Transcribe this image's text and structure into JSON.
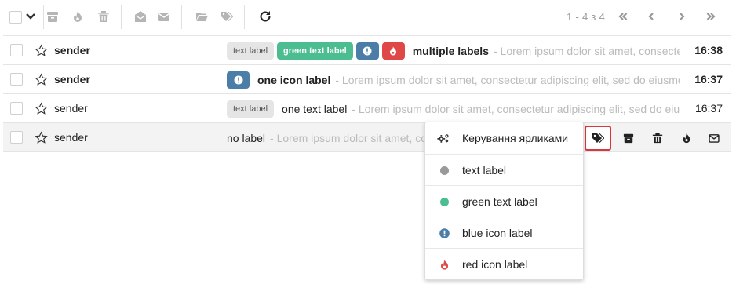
{
  "toolbar": {
    "pagination": "1 - 4 з 4",
    "icons": [
      "select-all-checkbox",
      "chevron-down-icon",
      "archive-icon",
      "spam-flame-icon",
      "trash-icon",
      "mark-read-icon",
      "mark-unread-icon",
      "move-folder-icon",
      "labels-icon",
      "refresh-icon"
    ]
  },
  "messages": [
    {
      "sender": "sender",
      "unread": true,
      "labels": [
        "text label",
        "green text label",
        "blue icon label",
        "red icon label"
      ],
      "subject": "multiple labels",
      "preview": "- Lorem ipsum dolor sit amet, consectetur adipiscing elit, sed do eiusmod tempor",
      "time": "16:38"
    },
    {
      "sender": "sender",
      "unread": true,
      "labels": [
        "blue icon label"
      ],
      "subject": "one icon label",
      "preview": "- Lorem ipsum dolor sit amet, consectetur adipiscing elit, sed do eiusmod tempor",
      "time": "16:37"
    },
    {
      "sender": "sender",
      "unread": false,
      "labels": [
        "text label"
      ],
      "subject": "one text label",
      "preview": "- Lorem ipsum dolor sit amet, consectetur adipiscing elit, sed do eiusmod tempor",
      "time": "16:37"
    },
    {
      "sender": "sender",
      "unread": false,
      "labels": [],
      "subject": "no label",
      "preview": "- Lorem ipsum dolor sit amet, consectetur adipiscing elit, sed do eiusmod tempor",
      "time": ""
    }
  ],
  "label_badges": {
    "text_label": "text label",
    "green_text_label": "green text label"
  },
  "dropdown": {
    "manage": "Керування ярликами",
    "items": [
      {
        "label": "text label",
        "color": "#999999",
        "icon": "gray-dot"
      },
      {
        "label": "green text label",
        "color": "#4bbd91",
        "icon": "green-dot"
      },
      {
        "label": "blue icon label",
        "color": "#4a7ea8",
        "icon": "info-icon"
      },
      {
        "label": "red icon label",
        "color": "#e04848",
        "icon": "flame-icon"
      }
    ]
  },
  "colors": {
    "green_label": "#4bbd91",
    "blue_label": "#4a7ea8",
    "red_label": "#e04848",
    "active_outline": "#d9363e"
  }
}
